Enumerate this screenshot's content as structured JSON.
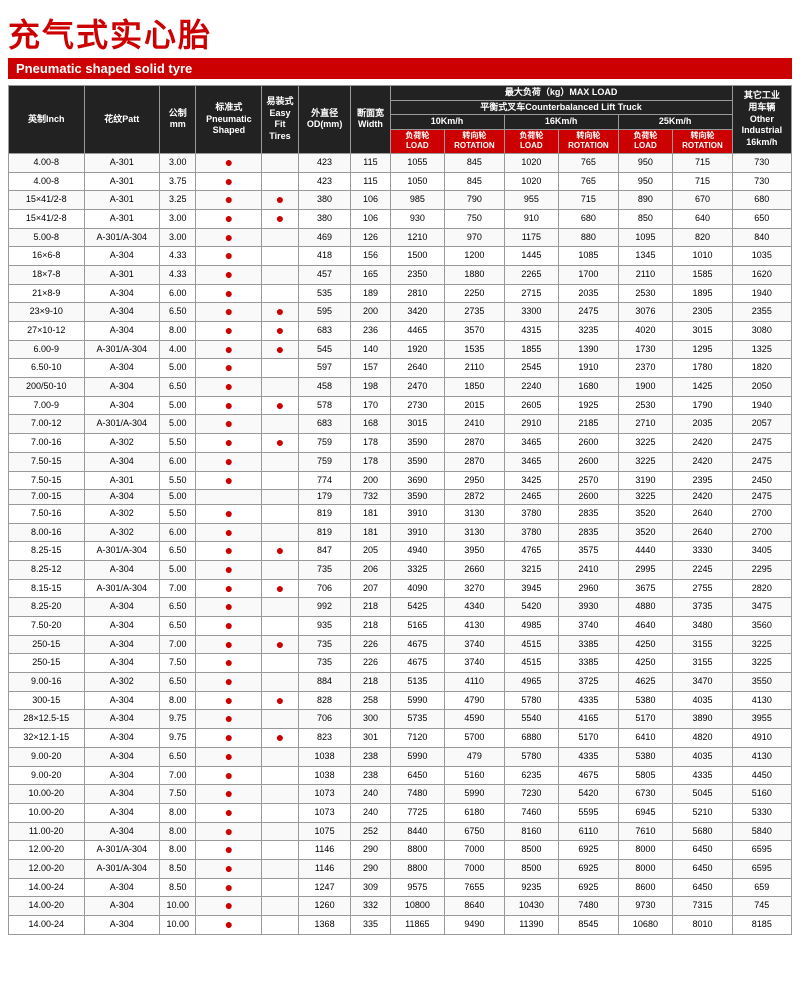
{
  "title": {
    "chinese": "充气式实心胎",
    "english": "Pneumatic shaped solid tyre"
  },
  "table": {
    "headers": {
      "inch": "英制Inch",
      "patt": "花纹Patt",
      "mm": "公制\nmm",
      "pneumatic": "标准式\nPneumatic\nShaped",
      "easy": "易装式\nEasy\nFit Tires",
      "od": "外直径\nOD(mm)",
      "width": "断面宽\nWidth",
      "maxload": "最大负荷（kg）MAX LOAD",
      "counterbalanced": "平衡式叉车Counterbalanced Lift Truck",
      "other": "其它工业用车辆\nOther\nIndustrial\n16km/h",
      "speed10": "10Km/h",
      "speed16": "16Km/h",
      "speed25": "25Km/h",
      "load": "负荷轮\nLOAD",
      "rotation": "转向轮\nROTATION"
    },
    "rows": [
      [
        "4.00-8",
        "A-301",
        "3.00",
        true,
        false,
        "423",
        "115",
        "1055",
        "845",
        "1020",
        "765",
        "950",
        "715",
        "730"
      ],
      [
        "4.00-8",
        "A-301",
        "3.75",
        true,
        false,
        "423",
        "115",
        "1050",
        "845",
        "1020",
        "765",
        "950",
        "715",
        "730"
      ],
      [
        "15×41/2-8",
        "A-301",
        "3.25",
        true,
        true,
        "380",
        "106",
        "985",
        "790",
        "955",
        "715",
        "890",
        "670",
        "680"
      ],
      [
        "15×41/2-8",
        "A-301",
        "3.00",
        true,
        true,
        "380",
        "106",
        "930",
        "750",
        "910",
        "680",
        "850",
        "640",
        "650"
      ],
      [
        "5.00-8",
        "A-301/A-304",
        "3.00",
        true,
        false,
        "469",
        "126",
        "1210",
        "970",
        "1175",
        "880",
        "1095",
        "820",
        "840"
      ],
      [
        "16×6-8",
        "A-304",
        "4.33",
        true,
        false,
        "418",
        "156",
        "1500",
        "1200",
        "1445",
        "1085",
        "1345",
        "1010",
        "1035"
      ],
      [
        "18×7-8",
        "A-301",
        "4.33",
        true,
        false,
        "457",
        "165",
        "2350",
        "1880",
        "2265",
        "1700",
        "2110",
        "1585",
        "1620"
      ],
      [
        "21×8-9",
        "A-304",
        "6.00",
        true,
        false,
        "535",
        "189",
        "2810",
        "2250",
        "2715",
        "2035",
        "2530",
        "1895",
        "1940"
      ],
      [
        "23×9-10",
        "A-304",
        "6.50",
        true,
        true,
        "595",
        "200",
        "3420",
        "2735",
        "3300",
        "2475",
        "3076",
        "2305",
        "2355"
      ],
      [
        "27×10-12",
        "A-304",
        "8.00",
        true,
        true,
        "683",
        "236",
        "4465",
        "3570",
        "4315",
        "3235",
        "4020",
        "3015",
        "3080"
      ],
      [
        "6.00-9",
        "A-301/A-304",
        "4.00",
        true,
        true,
        "545",
        "140",
        "1920",
        "1535",
        "1855",
        "1390",
        "1730",
        "1295",
        "1325"
      ],
      [
        "6.50-10",
        "A-304",
        "5.00",
        true,
        false,
        "597",
        "157",
        "2640",
        "2110",
        "2545",
        "1910",
        "2370",
        "1780",
        "1820"
      ],
      [
        "200/50-10",
        "A-304",
        "6.50",
        true,
        false,
        "458",
        "198",
        "2470",
        "1850",
        "2240",
        "1680",
        "1900",
        "1425",
        "2050"
      ],
      [
        "7.00-9",
        "A-304",
        "5.00",
        true,
        true,
        "578",
        "170",
        "2730",
        "2015",
        "2605",
        "1925",
        "2530",
        "1790",
        "1940"
      ],
      [
        "7.00-12",
        "A-301/A-304",
        "5.00",
        true,
        false,
        "683",
        "168",
        "3015",
        "2410",
        "2910",
        "2185",
        "2710",
        "2035",
        "2057"
      ],
      [
        "7.00-16",
        "A-302",
        "5.50",
        true,
        true,
        "759",
        "178",
        "3590",
        "2870",
        "3465",
        "2600",
        "3225",
        "2420",
        "2475"
      ],
      [
        "7.50-15",
        "A-304",
        "6.00",
        true,
        false,
        "759",
        "178",
        "3590",
        "2870",
        "3465",
        "2600",
        "3225",
        "2420",
        "2475"
      ],
      [
        "7.50-15",
        "A-301",
        "5.50",
        true,
        false,
        "774",
        "200",
        "3690",
        "2950",
        "3425",
        "2570",
        "3190",
        "2395",
        "2450"
      ],
      [
        "7.00-15",
        "A-304",
        "5.00",
        false,
        false,
        "179",
        "732",
        "3590",
        "2872",
        "2465",
        "2600",
        "3225",
        "2420",
        "2475"
      ],
      [
        "7.50-16",
        "A-302",
        "5.50",
        true,
        false,
        "819",
        "181",
        "3910",
        "3130",
        "3780",
        "2835",
        "3520",
        "2640",
        "2700"
      ],
      [
        "8.00-16",
        "A-302",
        "6.00",
        true,
        false,
        "819",
        "181",
        "3910",
        "3130",
        "3780",
        "2835",
        "3520",
        "2640",
        "2700"
      ],
      [
        "8.25-15",
        "A-301/A-304",
        "6.50",
        true,
        true,
        "847",
        "205",
        "4940",
        "3950",
        "4765",
        "3575",
        "4440",
        "3330",
        "3405"
      ],
      [
        "8.25-12",
        "A-304",
        "5.00",
        true,
        false,
        "735",
        "206",
        "3325",
        "2660",
        "3215",
        "2410",
        "2995",
        "2245",
        "2295"
      ],
      [
        "8.15-15",
        "A-301/A-304",
        "7.00",
        true,
        true,
        "706",
        "207",
        "4090",
        "3270",
        "3945",
        "2960",
        "3675",
        "2755",
        "2820"
      ],
      [
        "8.25-20",
        "A-304",
        "6.50",
        true,
        false,
        "992",
        "218",
        "5425",
        "4340",
        "5420",
        "3930",
        "4880",
        "3735",
        "3475"
      ],
      [
        "7.50-20",
        "A-304",
        "6.50",
        true,
        false,
        "935",
        "218",
        "5165",
        "4130",
        "4985",
        "3740",
        "4640",
        "3480",
        "3560"
      ],
      [
        "250-15",
        "A-304",
        "7.00",
        true,
        true,
        "735",
        "226",
        "4675",
        "3740",
        "4515",
        "3385",
        "4250",
        "3155",
        "3225"
      ],
      [
        "250-15",
        "A-304",
        "7.50",
        true,
        false,
        "735",
        "226",
        "4675",
        "3740",
        "4515",
        "3385",
        "4250",
        "3155",
        "3225"
      ],
      [
        "9.00-16",
        "A-302",
        "6.50",
        true,
        false,
        "884",
        "218",
        "5135",
        "4110",
        "4965",
        "3725",
        "4625",
        "3470",
        "3550"
      ],
      [
        "300-15",
        "A-304",
        "8.00",
        true,
        true,
        "828",
        "258",
        "5990",
        "4790",
        "5780",
        "4335",
        "5380",
        "4035",
        "4130"
      ],
      [
        "28×12.5-15",
        "A-304",
        "9.75",
        true,
        false,
        "706",
        "300",
        "5735",
        "4590",
        "5540",
        "4165",
        "5170",
        "3890",
        "3955"
      ],
      [
        "32×12.1-15",
        "A-304",
        "9.75",
        true,
        true,
        "823",
        "301",
        "7120",
        "5700",
        "6880",
        "5170",
        "6410",
        "4820",
        "4910"
      ],
      [
        "9.00-20",
        "A-304",
        "6.50",
        true,
        false,
        "1038",
        "238",
        "5990",
        "479",
        "5780",
        "4335",
        "5380",
        "4035",
        "4130"
      ],
      [
        "9.00-20",
        "A-304",
        "7.00",
        true,
        false,
        "1038",
        "238",
        "6450",
        "5160",
        "6235",
        "4675",
        "5805",
        "4335",
        "4450"
      ],
      [
        "10.00-20",
        "A-304",
        "7.50",
        true,
        false,
        "1073",
        "240",
        "7480",
        "5990",
        "7230",
        "5420",
        "6730",
        "5045",
        "5160"
      ],
      [
        "10.00-20",
        "A-304",
        "8.00",
        true,
        false,
        "1073",
        "240",
        "7725",
        "6180",
        "7460",
        "5595",
        "6945",
        "5210",
        "5330"
      ],
      [
        "11.00-20",
        "A-304",
        "8.00",
        true,
        false,
        "1075",
        "252",
        "8440",
        "6750",
        "8160",
        "6110",
        "7610",
        "5680",
        "5840"
      ],
      [
        "12.00-20",
        "A-301/A-304",
        "8.00",
        true,
        false,
        "1146",
        "290",
        "8800",
        "7000",
        "8500",
        "6925",
        "8000",
        "6450",
        "6595"
      ],
      [
        "12.00-20",
        "A-301/A-304",
        "8.50",
        true,
        false,
        "1146",
        "290",
        "8800",
        "7000",
        "8500",
        "6925",
        "8000",
        "6450",
        "6595"
      ],
      [
        "14.00-24",
        "A-304",
        "8.50",
        true,
        false,
        "1247",
        "309",
        "9575",
        "7655",
        "9235",
        "6925",
        "8600",
        "6450",
        "659"
      ],
      [
        "14.00-20",
        "A-304",
        "10.00",
        true,
        false,
        "1260",
        "332",
        "10800",
        "8640",
        "10430",
        "7480",
        "9730",
        "7315",
        "745"
      ],
      [
        "14.00-24",
        "A-304",
        "10.00",
        true,
        false,
        "1368",
        "335",
        "11865",
        "9490",
        "11390",
        "8545",
        "10680",
        "8010",
        "8185"
      ]
    ]
  }
}
